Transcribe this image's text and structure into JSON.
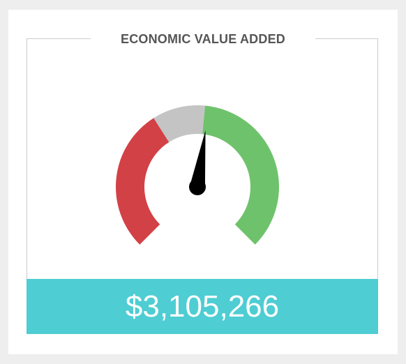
{
  "widget": {
    "title": "ECONOMIC VALUE ADDED",
    "value": "$3,105,266"
  },
  "gauge": {
    "segments": [
      {
        "name": "red",
        "from": 0,
        "to": 0.38,
        "color": "#d24146"
      },
      {
        "name": "gray",
        "from": 0.38,
        "to": 0.52,
        "color": "#c4c4c4"
      },
      {
        "name": "green",
        "from": 0.52,
        "to": 1,
        "color": "#6fc26c"
      }
    ],
    "needle_fraction": 0.53,
    "needle_color": "#000000"
  },
  "colors": {
    "accent": "#4ecdd3",
    "background": "#eeeeee",
    "card": "#ffffff",
    "title": "#555555"
  }
}
